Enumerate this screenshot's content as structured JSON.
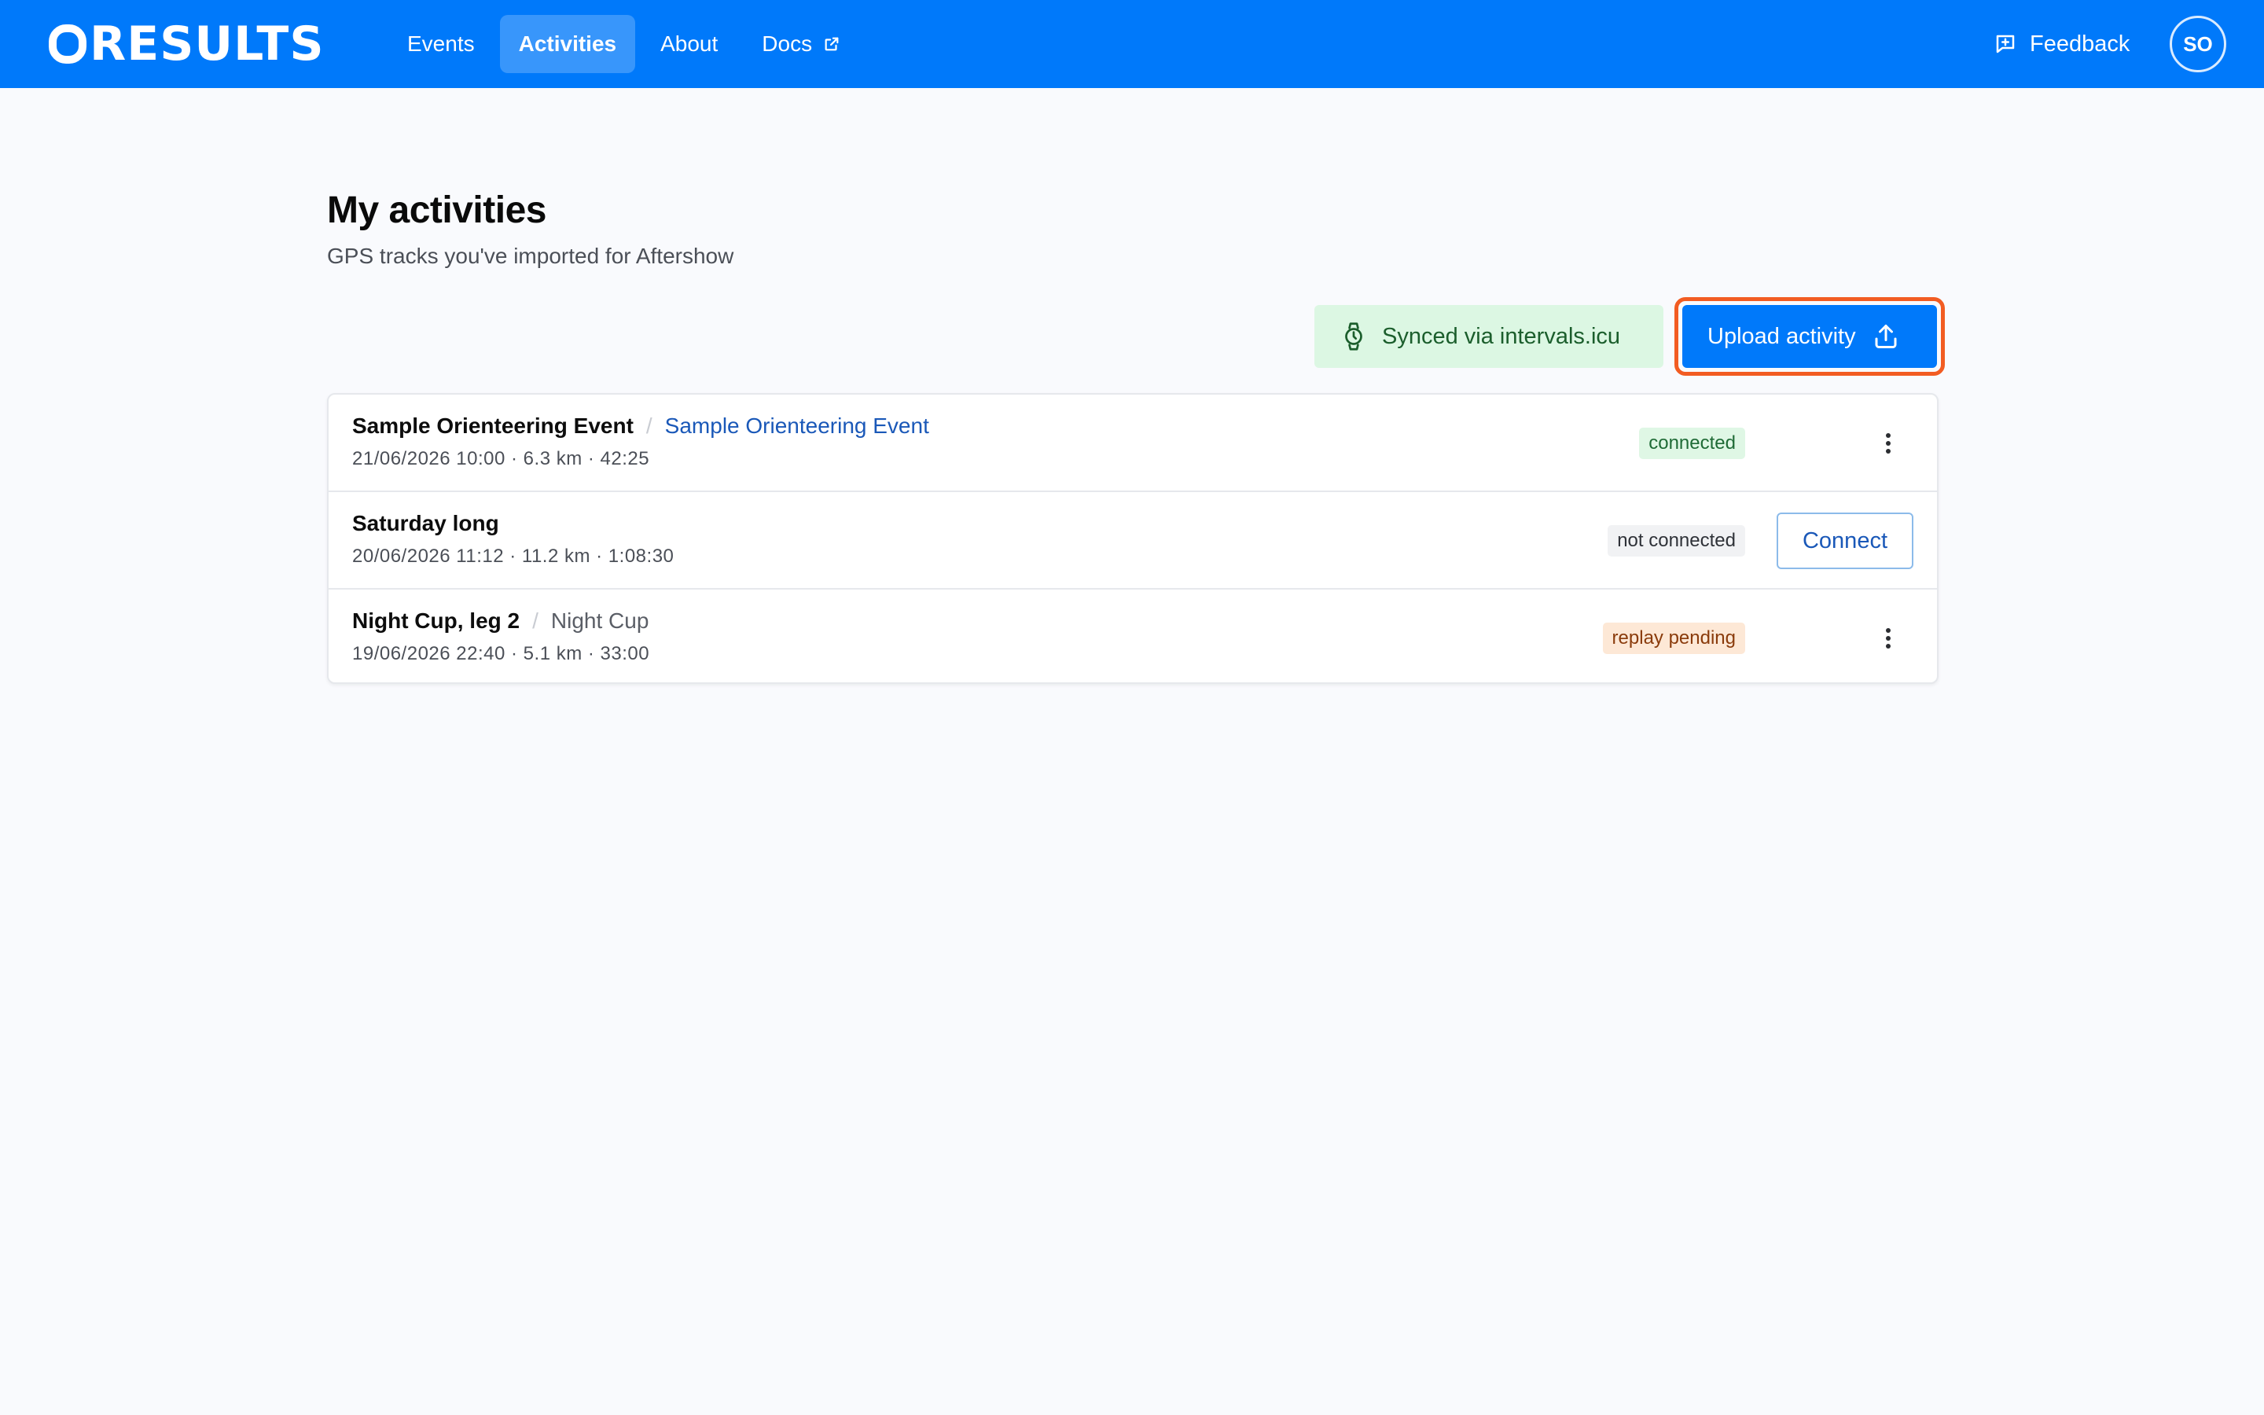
{
  "brand": {
    "logo_text": "RESULTS"
  },
  "nav": {
    "items": [
      {
        "label": "Events",
        "active": false
      },
      {
        "label": "Activities",
        "active": true
      },
      {
        "label": "About",
        "active": false
      },
      {
        "label": "Docs",
        "active": false,
        "external": true
      }
    ]
  },
  "header_actions": {
    "feedback_label": "Feedback",
    "avatar_initials": "SO"
  },
  "page": {
    "title": "My activities",
    "subtitle": "GPS tracks you've imported for Aftershow"
  },
  "actions": {
    "sync_label": "Synced via intervals.icu",
    "upload_label": "Upload activity"
  },
  "activities": [
    {
      "name": "Sample Orienteering Event",
      "separator": "/",
      "event": "Sample Orienteering Event",
      "meta": "21/06/2026 10:00 · 6.3 km · 42:25",
      "status": "connected"
    },
    {
      "name": "Saturday long",
      "meta": "20/06/2026 11:12 · 11.2 km · 1:08:30",
      "status": "not connected",
      "action_label": "Connect"
    },
    {
      "name": "Night Cup, leg 2",
      "separator": "/",
      "event": "Night Cup",
      "meta": "19/06/2026 22:40 · 5.1 km · 33:00",
      "status": "replay pending"
    }
  ],
  "colors": {
    "brand_blue": "#0079fa",
    "highlight_orange": "#f25c22",
    "connected_bg": "#dff7e5",
    "pending_bg": "#fde8d6",
    "sync_bg": "#dcf7e3"
  }
}
